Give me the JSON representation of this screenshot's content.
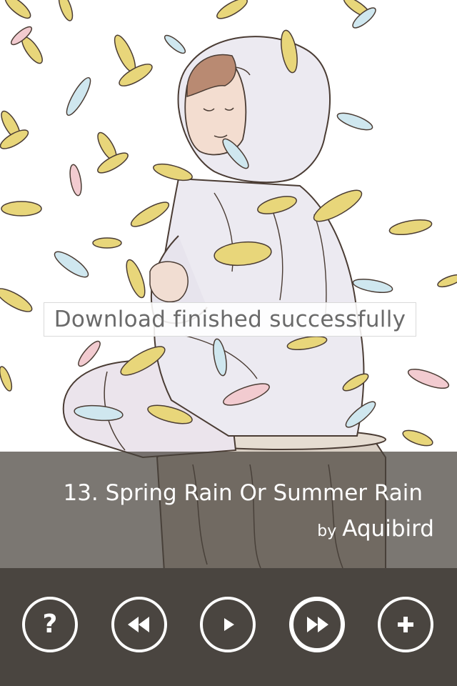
{
  "toast": {
    "message": "Download finished successfully"
  },
  "now_playing": {
    "title": "13. Spring Rain Or Summer Rain",
    "artist_prefix": "by",
    "artist": "Aquibird"
  },
  "controls": {
    "help_glyph": "?",
    "buttons": [
      "help",
      "rewind",
      "play",
      "fast-forward",
      "add"
    ]
  },
  "artwork": {
    "subject": "illustrated child in hooded sweatshirt sitting on tree stump with falling leaves",
    "icon_names": [
      "question-mark-icon",
      "rewind-icon",
      "play-icon",
      "fast-forward-icon",
      "plus-icon"
    ]
  },
  "colors": {
    "panel": "#4a4540",
    "panel_translucent": "rgba(72,66,60,0.72)",
    "text": "#ffffff",
    "toast_text": "#6a6a6a",
    "leaf_yellow": "#e8d67a",
    "leaf_blue": "#cfe7ef",
    "leaf_pink": "#f2cbd0",
    "hoodie": "#e9e6ee",
    "hair": "#b98a72"
  }
}
